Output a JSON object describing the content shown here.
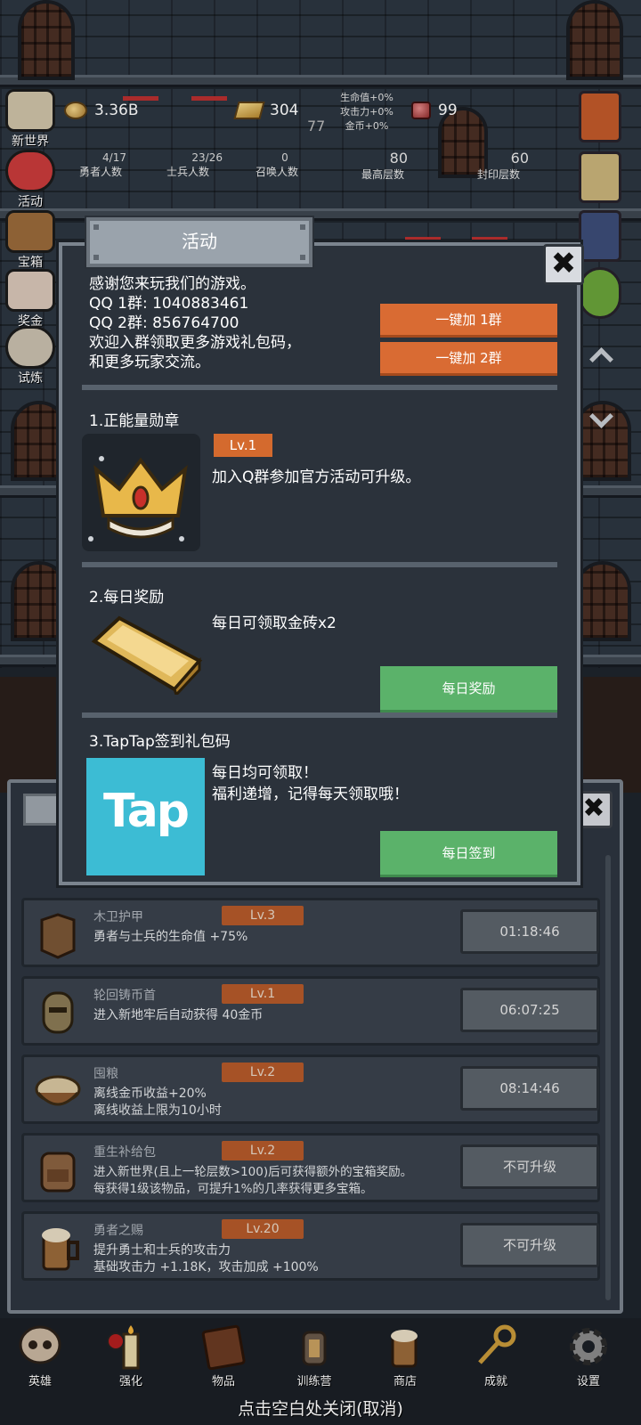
{
  "hud": {
    "coins": "3.36B",
    "gold_bars": "304",
    "gems": "99",
    "small_number": "77",
    "buffs": [
      "生命值+0%",
      "攻击力+0%",
      "金币+0%"
    ],
    "stats": [
      {
        "value": "4/17",
        "label": "勇者人数"
      },
      {
        "value": "23/26",
        "label": "士兵人数"
      },
      {
        "value": "0",
        "label": "召唤人数"
      },
      {
        "value": "80",
        "label": "最高层数"
      },
      {
        "value": "60",
        "label": "封印层数"
      }
    ]
  },
  "left_menu": [
    "新世界",
    "活动",
    "宝箱",
    "奖金",
    "试炼"
  ],
  "dialog": {
    "title": "活动",
    "close_label": "✖",
    "intro": "感谢您来玩我们的游戏。\nQQ 1群: 1040883461\nQQ 2群: 856764700\n欢迎入群领取更多游戏礼包码，\n和更多玩家交流。",
    "join_group1": "一键加 1群",
    "join_group2": "一键加 2群",
    "section1": {
      "title": "1.正能量勋章",
      "level": "Lv.1",
      "text": "加入Q群参加官方活动可升级。"
    },
    "section2": {
      "title": "2.每日奖励",
      "text": "每日可领取金砖x2",
      "button": "每日奖励"
    },
    "section3": {
      "title": "3.TapTap签到礼包码",
      "logo_text": "Tap",
      "text": "每日均可领取！\n福利递增，记得每天领取哦！",
      "button": "每日签到"
    }
  },
  "upgrades": [
    {
      "name": "木卫护甲",
      "level": "Lv.3",
      "desc": "勇者与士兵的生命值 +75%",
      "button": "01:18:46"
    },
    {
      "name": "轮回铸币首",
      "level": "Lv.1",
      "desc": "进入新地牢后自动获得 40金币",
      "button": "06:07:25"
    },
    {
      "name": "囤粮",
      "level": "Lv.2",
      "desc": "离线金币收益+20%\n离线收益上限为10小时",
      "button": "08:14:46"
    },
    {
      "name": "重生补给包",
      "level": "Lv.2",
      "desc": "进入新世界(且上一轮层数>100)后可获得额外的宝箱奖励。\n每获得1级该物品，可提升1%的几率获得更多宝箱。",
      "button": "不可升级"
    },
    {
      "name": "勇者之赐",
      "level": "Lv.20",
      "desc": "提升勇士和士兵的攻击力\n基础攻击力 +1.18K，攻击加成 +100%",
      "button": "不可升级"
    }
  ],
  "bottom_nav": [
    "英雄",
    "强化",
    "物品",
    "训练营",
    "商店",
    "成就",
    "设置"
  ],
  "close_hint": "点击空白处关闭(取消)",
  "colors": {
    "orange_button": "#d96b33",
    "green_button": "#5bb26a",
    "level_tag": "#d46a2e",
    "tap_brand": "#3cbcd4",
    "panel": "#2b323b"
  }
}
